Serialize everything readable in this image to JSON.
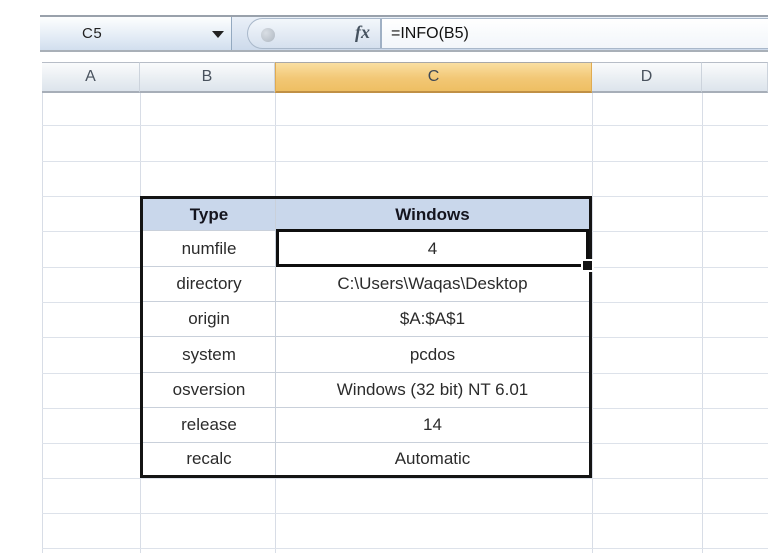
{
  "formula_bar": {
    "name_box_value": "C5",
    "fx_label": "fx",
    "formula": "=INFO(B5)"
  },
  "column_headers": {
    "a": "A",
    "b": "B",
    "c": "C",
    "d": "D",
    "selected": "C"
  },
  "info_table": {
    "header": {
      "type": "Type",
      "value": "Windows"
    },
    "rows": [
      {
        "label": "numfile",
        "value": "4"
      },
      {
        "label": "directory",
        "value": "C:\\Users\\Waqas\\Desktop"
      },
      {
        "label": "origin",
        "value": "$A:$A$1"
      },
      {
        "label": "system",
        "value": "pcdos"
      },
      {
        "label": "osversion",
        "value": "Windows (32 bit) NT 6.01"
      },
      {
        "label": "release",
        "value": "14"
      },
      {
        "label": "recalc",
        "value": "Automatic"
      }
    ]
  },
  "selection": {
    "active_cell": "C5",
    "active_value": "4"
  },
  "colors": {
    "selected_column_header": "#f2c775",
    "table_header_bg": "#c9d7eb",
    "selection_border": "#0f0f0f",
    "gridline": "#d8dde6"
  }
}
